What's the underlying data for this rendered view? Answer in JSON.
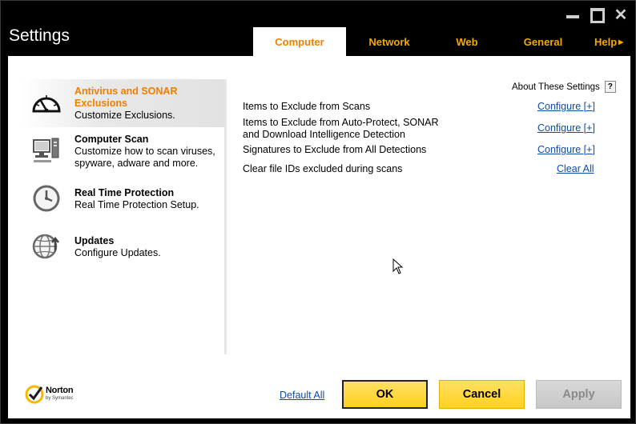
{
  "window": {
    "title": "Settings"
  },
  "tabs": [
    {
      "label": "Computer"
    },
    {
      "label": "Network"
    },
    {
      "label": "Web"
    },
    {
      "label": "General"
    },
    {
      "label": "Help"
    }
  ],
  "sidebar": {
    "items": [
      {
        "title_line1": "Antivirus and SONAR",
        "title_line2": "Exclusions",
        "desc": "Customize Exclusions.",
        "icon": "gauge-icon"
      },
      {
        "title_line1": "Computer Scan",
        "desc_line1": "Customize how to scan viruses,",
        "desc_line2": "spyware, adware and more.",
        "icon": "computer-icon"
      },
      {
        "title_line1": "Real Time Protection",
        "desc": "Real Time Protection Setup.",
        "icon": "clock-icon"
      },
      {
        "title_line1": "Updates",
        "desc": "Configure Updates.",
        "icon": "globe-update-icon"
      }
    ]
  },
  "main": {
    "about_label": "About These Settings",
    "help_symbol": "?",
    "rows": [
      {
        "label_line1": "Items to Exclude from Scans",
        "action": "Configure [+]"
      },
      {
        "label_line1": "Items to Exclude from Auto-Protect, SONAR",
        "label_line2": "and Download Intelligence Detection",
        "action": "Configure [+]"
      },
      {
        "label_line1": "Signatures to Exclude from All Detections",
        "action": "Configure [+]"
      },
      {
        "label_line1": "Clear file IDs excluded during scans",
        "action": "Clear All"
      }
    ]
  },
  "footer": {
    "logo_name": "Norton",
    "logo_sub": "by Symantec",
    "default_all": "Default All",
    "ok": "OK",
    "cancel": "Cancel",
    "apply": "Apply"
  },
  "colors": {
    "accent_orange": "#f07f00",
    "tab_yellow": "#f6a800",
    "button_yellow": "#ffd21a",
    "link_blue": "#0b4da5"
  }
}
